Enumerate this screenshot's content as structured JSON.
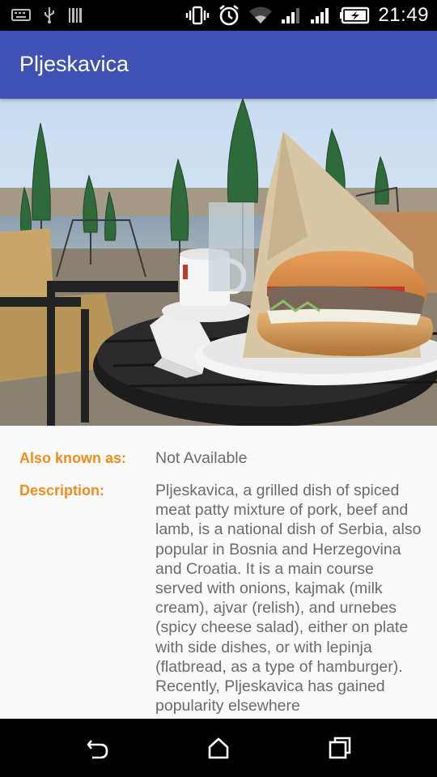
{
  "status_bar": {
    "time": "21:49",
    "icons": [
      "keyboard-icon",
      "usb-icon",
      "barcode-icon",
      "vibrate-icon",
      "alarm-icon",
      "wifi-icon",
      "signal-icon",
      "signal-icon",
      "battery-charging-icon"
    ]
  },
  "app_bar": {
    "title": "Pljeskavica",
    "color": "#3f51b5"
  },
  "hero_image": {
    "subject": "pljeskavica-burger-photo"
  },
  "details": {
    "also_known_as_label": "Also known as:",
    "also_known_as_value": "Not Available",
    "description_label": "Description:",
    "description_value": "Pljeskavica, a grilled dish of spiced meat patty mixture of pork, beef and lamb, is a national dish of Serbia, also popular in Bosnia and Herzegovina and Croatia. It is a main course served with onions, kajmak (milk cream), ajvar (relish), and urnebes (spicy cheese salad), either on plate with side dishes, or with lepinja (flatbread, as a type of hamburger). Recently, Pljeskavica has gained popularity elsewhere",
    "label_color": "#f08c1c"
  },
  "nav_bar": {
    "buttons": [
      "back-icon",
      "home-icon",
      "recents-icon"
    ]
  }
}
